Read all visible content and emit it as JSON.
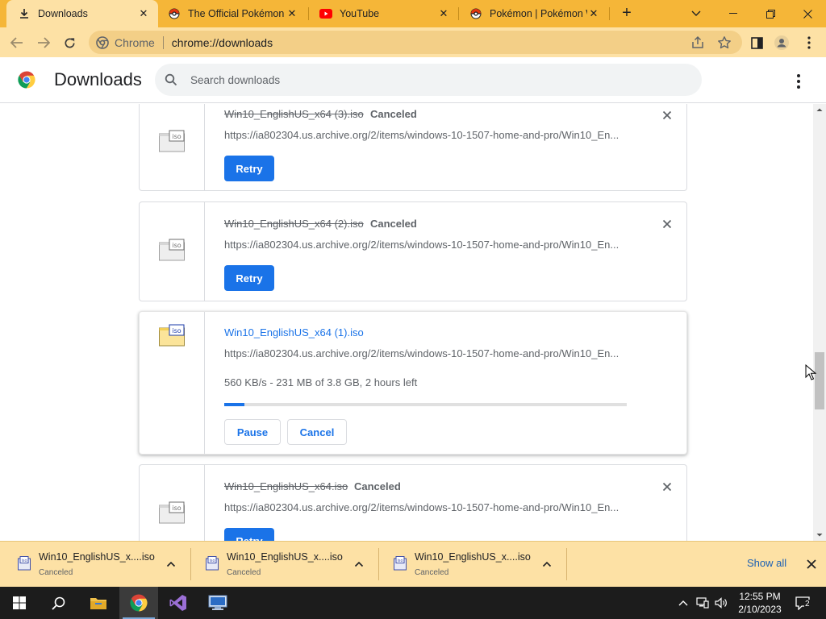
{
  "tabs": [
    {
      "title": "Downloads",
      "favicon": "download-icon",
      "active": true
    },
    {
      "title": "The Official Pokémon W",
      "favicon": "pokeball-icon",
      "active": false
    },
    {
      "title": "YouTube",
      "favicon": "youtube-icon",
      "active": false
    },
    {
      "title": "Pokémon | Pokémon W",
      "favicon": "pokeball-icon",
      "active": false
    }
  ],
  "toolbar": {
    "scheme_label": "Chrome",
    "url": "chrome://downloads"
  },
  "page": {
    "title": "Downloads",
    "search_placeholder": "Search downloads"
  },
  "downloads": [
    {
      "filename": "Win10_EnglishUS_x64 (3).iso",
      "status": "Canceled",
      "url": "https://ia802304.us.archive.org/2/items/windows-10-1507-home-and-pro/Win10_En...",
      "action": "Retry"
    },
    {
      "filename": "Win10_EnglishUS_x64 (2).iso",
      "status": "Canceled",
      "url": "https://ia802304.us.archive.org/2/items/windows-10-1507-home-and-pro/Win10_En...",
      "action": "Retry"
    },
    {
      "filename": "Win10_EnglishUS_x64 (1).iso",
      "url": "https://ia802304.us.archive.org/2/items/windows-10-1507-home-and-pro/Win10_En...",
      "progress_text": "560 KB/s - 231 MB of 3.8 GB, 2 hours left",
      "progress_fraction": 0.05,
      "pause_label": "Pause",
      "cancel_label": "Cancel"
    },
    {
      "filename": "Win10_EnglishUS_x64.iso",
      "status": "Canceled",
      "url": "https://ia802304.us.archive.org/2/items/windows-10-1507-home-and-pro/Win10_En...",
      "action": "Retry"
    }
  ],
  "shelf": {
    "items": [
      {
        "name": "Win10_EnglishUS_x....iso",
        "status": "Canceled"
      },
      {
        "name": "Win10_EnglishUS_x....iso",
        "status": "Canceled"
      },
      {
        "name": "Win10_EnglishUS_x....iso",
        "status": "Canceled"
      }
    ],
    "show_all_label": "Show all"
  },
  "taskbar": {
    "time": "12:55 PM",
    "date": "2/10/2023",
    "notification_count": "2"
  },
  "colors": {
    "tabstrip": "#f5b638",
    "toolbar": "#fde1a5",
    "accent": "#1a73e8"
  }
}
